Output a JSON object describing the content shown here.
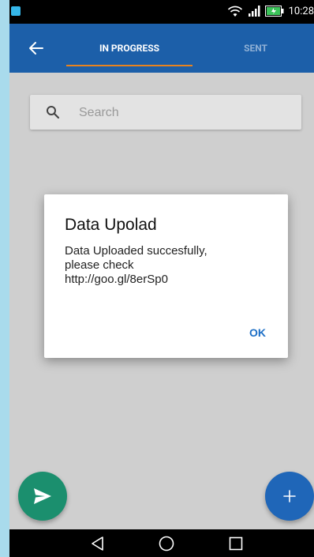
{
  "status_bar": {
    "time": "10:28",
    "icons": [
      "notification-icon",
      "wifi-icon",
      "signal-icon",
      "battery-icon"
    ]
  },
  "app_bar": {
    "back_icon": "arrow-back-icon",
    "tabs": [
      {
        "label": "IN PROGRESS",
        "active": true
      },
      {
        "label": "SENT",
        "active": false
      }
    ],
    "colors": {
      "background": "#1c5fa9",
      "indicator": "#e8831f"
    }
  },
  "search": {
    "placeholder": "Search",
    "value": "",
    "icon": "search-icon"
  },
  "dialog": {
    "title": "Data Upolad",
    "body_line1": "Data Uploaded succesfully,",
    "body_line2": "please check",
    "body_line3": "http://goo.gl/8erSp0",
    "ok_label": "OK"
  },
  "fabs": [
    {
      "name": "send",
      "icon": "send-icon",
      "color": "#1b8f6e"
    },
    {
      "name": "add",
      "icon": "plus-icon",
      "color": "#1f66b8"
    }
  ],
  "nav_bar": {
    "icons": [
      "back-triangle-icon",
      "home-circle-icon",
      "recents-square-icon"
    ]
  }
}
